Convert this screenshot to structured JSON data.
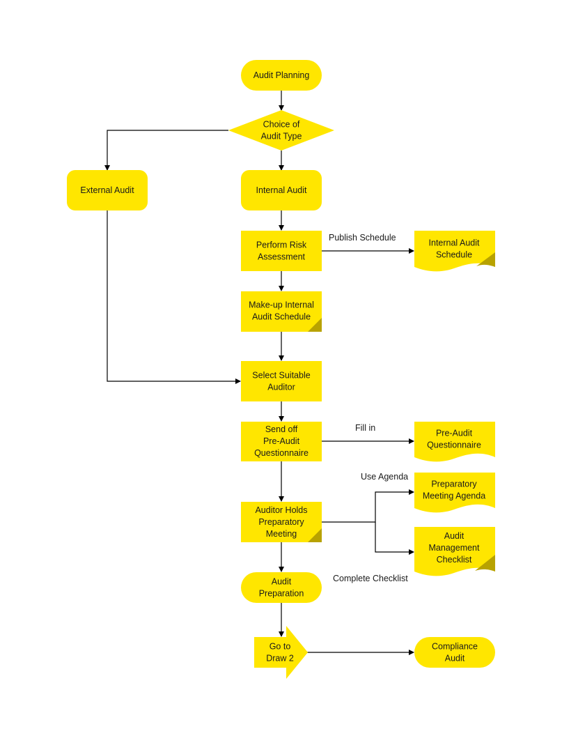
{
  "colors": {
    "fill": "#FFE600",
    "fold": "#B8A200",
    "line": "#000000",
    "text": "#1a1a1a"
  },
  "nodes": {
    "audit_planning": {
      "shape": "terminator",
      "lines": [
        "Audit Planning"
      ]
    },
    "choice_audit_type": {
      "shape": "decision",
      "lines": [
        "Choice of",
        "Audit Type"
      ]
    },
    "external_audit": {
      "shape": "rounded-process",
      "lines": [
        "External Audit"
      ]
    },
    "internal_audit": {
      "shape": "rounded-process",
      "lines": [
        "Internal Audit"
      ]
    },
    "perform_risk_assessment": {
      "shape": "process",
      "lines": [
        "Perform Risk",
        "Assessment"
      ]
    },
    "internal_audit_schedule_doc": {
      "shape": "document",
      "lines": [
        "Internal Audit",
        "Schedule"
      ]
    },
    "makeup_internal_schedule": {
      "shape": "process-fold",
      "lines": [
        "Make-up Internal",
        "Audit Schedule"
      ]
    },
    "select_suitable_auditor": {
      "shape": "process",
      "lines": [
        "Select Suitable",
        "Auditor"
      ]
    },
    "send_off_questionnaire": {
      "shape": "process",
      "lines": [
        "Send off",
        "Pre-Audit",
        "Questionnaire"
      ]
    },
    "pre_audit_questionnaire_doc": {
      "shape": "document",
      "lines": [
        "Pre-Audit",
        "Questionnaire"
      ]
    },
    "preparatory_meeting_agenda_doc": {
      "shape": "document",
      "lines": [
        "Preparatory",
        "Meeting Agenda"
      ]
    },
    "auditor_holds_meeting": {
      "shape": "process-fold",
      "lines": [
        "Auditor Holds",
        "Preparatory",
        "Meeting"
      ]
    },
    "audit_management_checklist_doc": {
      "shape": "document",
      "lines": [
        "Audit",
        "Management",
        "Checklist"
      ]
    },
    "audit_preparation": {
      "shape": "terminator",
      "lines": [
        "Audit",
        "Preparation"
      ]
    },
    "go_to_draw_2": {
      "shape": "offpage-arrow",
      "lines": [
        "Go to",
        "Draw 2"
      ]
    },
    "compliance_audit": {
      "shape": "terminator",
      "lines": [
        "Compliance",
        "Audit"
      ]
    }
  },
  "edge_labels": {
    "publish_schedule": "Publish Schedule",
    "fill_in": "Fill in",
    "use_agenda": "Use Agenda",
    "complete_checklist": "Complete Checklist"
  }
}
